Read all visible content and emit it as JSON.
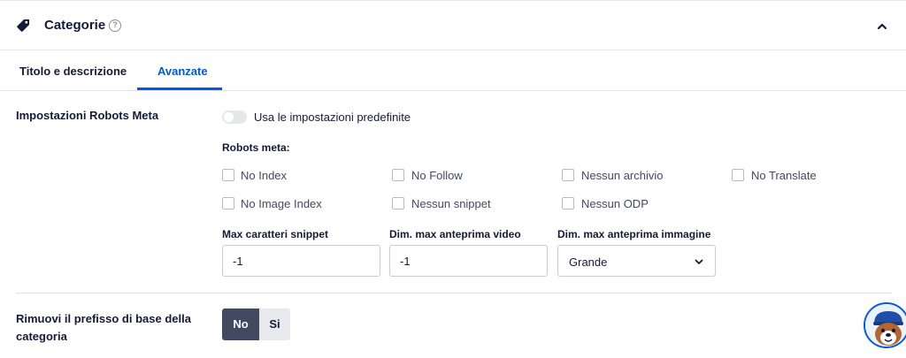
{
  "header": {
    "title": "Categorie",
    "help": "?",
    "icon": "tag-icon",
    "collapse_icon": "chevron-up-icon"
  },
  "tabs": [
    {
      "label": "Titolo e descrizione",
      "active": false
    },
    {
      "label": "Avanzate",
      "active": true
    }
  ],
  "robots_meta_setting": {
    "label": "Impostazioni Robots Meta",
    "toggle_label": "Usa le impostazioni predefinite",
    "toggle_on": false,
    "robots_title": "Robots meta:",
    "checkboxes": [
      {
        "label": "No Index",
        "checked": false
      },
      {
        "label": "No Follow",
        "checked": false
      },
      {
        "label": "Nessun archivio",
        "checked": false
      },
      {
        "label": "No Translate",
        "checked": false
      },
      {
        "label": "No Image Index",
        "checked": false
      },
      {
        "label": "Nessun snippet",
        "checked": false
      },
      {
        "label": "Nessun ODP",
        "checked": false
      }
    ],
    "fields": {
      "max_snippet": {
        "label": "Max caratteri snippet",
        "value": "-1"
      },
      "max_video": {
        "label": "Dim. max anteprima video",
        "value": "-1"
      },
      "max_image": {
        "label": "Dim. max anteprima immagine",
        "value": "Grande"
      }
    }
  },
  "prefix_setting": {
    "label": "Rimuovi il prefisso di base della categoria",
    "options": [
      "No",
      "Si"
    ],
    "selected": "No"
  },
  "colors": {
    "accent": "#005ae0",
    "dark": "#141b38",
    "segment_active": "#434960"
  }
}
